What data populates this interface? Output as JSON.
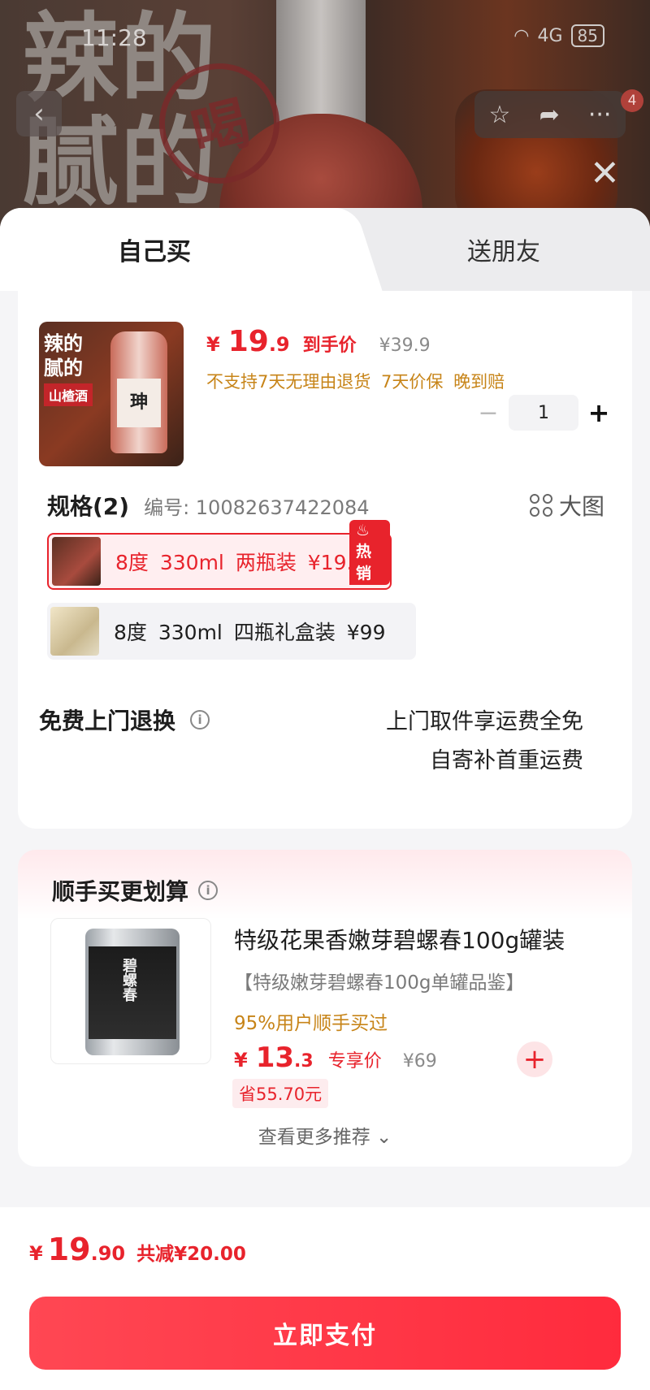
{
  "status_bar": {
    "time": "11:28",
    "battery": "85",
    "network": "4G"
  },
  "hero": {
    "banner_text_line1": "辣的",
    "banner_text_line2": "腻的",
    "stamp_text": "喝",
    "badge_count": "4"
  },
  "tabs": [
    {
      "label": "自己买"
    },
    {
      "label": "送朋友"
    }
  ],
  "product": {
    "image_line1": "辣的",
    "image_line2": "腻的",
    "image_tag": "山楂酒",
    "image_label": "珅",
    "currency": "¥",
    "price_int": "19",
    "price_dec": ".9",
    "price_tag": "到手价",
    "original_price": "¥39.9",
    "policy": "不支持7天无理由退货 7天价保 晚到赔",
    "quantity": "1"
  },
  "spec": {
    "title": "规格(2)",
    "code": "编号: 10082637422084",
    "big_image": "大图",
    "options": [
      {
        "label": "8度 330ml  两瓶装  ¥19.9",
        "badge": "热销",
        "selected": true
      },
      {
        "label": "8度 330ml  四瓶礼盒装  ¥99",
        "selected": false
      }
    ]
  },
  "return_service": {
    "title": "免费上门退换",
    "line1": "上门取件享运费全免",
    "line2": "自寄补首重运费"
  },
  "recommend": {
    "title": "顺手买更划算",
    "item": {
      "name": "特级花果香嫩芽碧螺春100g罐装",
      "subtitle": "【特级嫩芽碧螺春100g单罐品鉴】",
      "purchase_rate": "95%用户顺手买过",
      "currency": "¥",
      "price_int": "13",
      "price_dec": ".3",
      "price_tag": "专享价",
      "original_price": "¥69",
      "save": "省55.70元",
      "can_text": "碧螺春"
    },
    "more": "查看更多推荐 ⌄"
  },
  "footer": {
    "currency": "¥",
    "total_int": "19",
    "total_dec": ".90",
    "discount": "共减¥20.00",
    "pay_button": "立即支付"
  },
  "colors": {
    "accent": "#e8232c",
    "policy": "#c78418",
    "pay_start": "#ff4753",
    "pay_end": "#ff2b3d"
  },
  "icons": [
    "back-icon",
    "star-icon",
    "share-icon",
    "more-icon",
    "close-icon",
    "minus-icon",
    "plus-icon",
    "grid-icon",
    "info-icon",
    "fire-icon",
    "add-icon",
    "chevron-down-icon"
  ]
}
